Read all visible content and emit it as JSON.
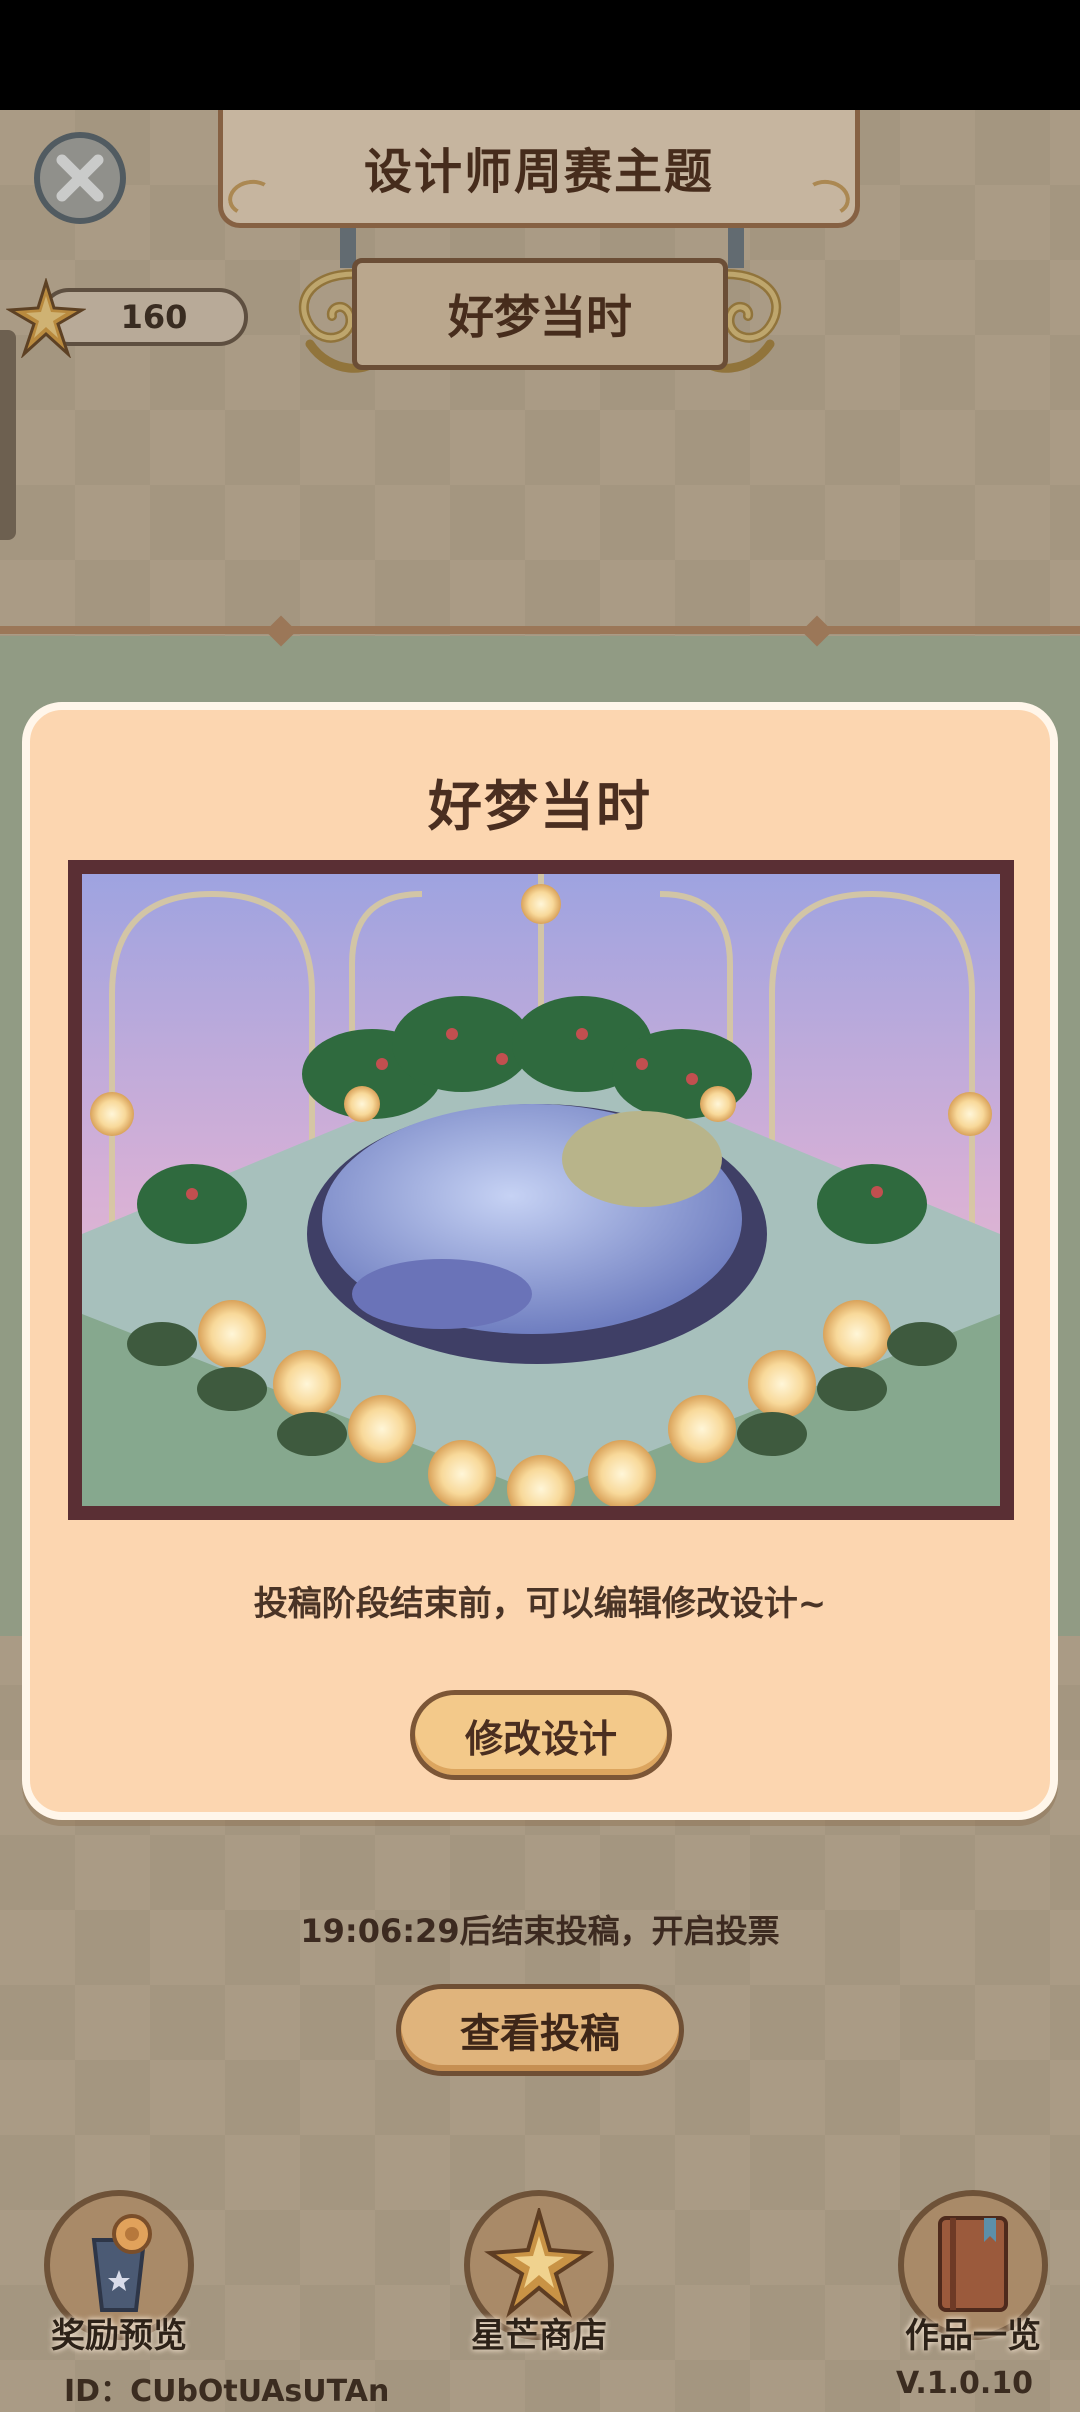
{
  "header": {
    "title": "设计师周赛主题",
    "subtitle": "好梦当时",
    "star_count": "160"
  },
  "modal": {
    "title": "好梦当时",
    "hint": "投稿阶段结束前，可以编辑修改设计~",
    "edit_button": "修改设计"
  },
  "countdown": "19:06:29后结束投稿，开启投票",
  "view_submissions_button": "查看投稿",
  "bottom_nav": [
    {
      "label": "奖励预览",
      "icon": "trophy-cup-icon"
    },
    {
      "label": "星芒商店",
      "icon": "star-shop-icon"
    },
    {
      "label": "作品一览",
      "icon": "book-icon"
    }
  ],
  "footer": {
    "user_id": "ID：CUbOtUAsUTAn",
    "version": "V.1.0.10"
  },
  "colors": {
    "modal_bg": "#fcd6b0",
    "button_fill": "#f3c98a",
    "frame": "#5a2f34"
  }
}
